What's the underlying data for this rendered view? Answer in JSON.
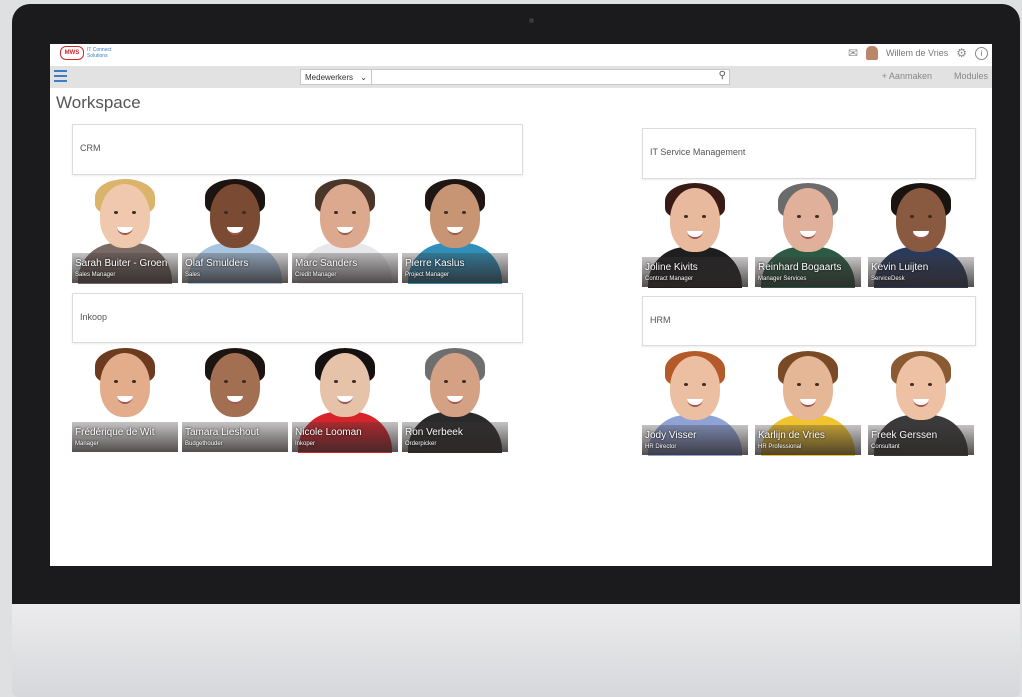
{
  "header": {
    "logo_badge": "MWS",
    "logo_text": "IT Connect Solutions",
    "user_name": "Willem de Vries"
  },
  "toolbar": {
    "search_scope": "Medewerkers",
    "create_label": "+ Aanmaken",
    "modules_label": "Modules"
  },
  "page": {
    "title": "Workspace"
  },
  "groups": [
    {
      "title": "CRM",
      "people": [
        {
          "name": "Sarah Buiter - Groen",
          "role": "Sales Manager",
          "skin": "#f0c8ad",
          "hair": "#d9b46a",
          "shirt": "#7a6a66",
          "bg": "#ffffff"
        },
        {
          "name": "Olaf Smulders",
          "role": "Sales",
          "skin": "#7a4a33",
          "hair": "#1c1411",
          "shirt": "#a8c4de",
          "bg": "#ffffff"
        },
        {
          "name": "Marc Sanders",
          "role": "Credit Manager",
          "skin": "#dca98e",
          "hair": "#4a3628",
          "shirt": "#e8e8ea",
          "bg": "#ffffff"
        },
        {
          "name": "Pierre Kaslus",
          "role": "Project Manager",
          "skin": "#c89574",
          "hair": "#1d1612",
          "shirt": "#2f8fb8",
          "bg": "#ffffff"
        }
      ]
    },
    {
      "title": "Inkoop",
      "people": [
        {
          "name": "Frédérique de Wit",
          "role": "Manager",
          "skin": "#e3ad8c",
          "hair": "#6b3a1f",
          "shirt": "#ffffff",
          "bg": "#ffffff"
        },
        {
          "name": "Tamara Lieshout",
          "role": "Budgethouder",
          "skin": "#a36f52",
          "hair": "#1c1411",
          "shirt": "#ffffff",
          "bg": "#ffffff"
        },
        {
          "name": "Nicole Looman",
          "role": "Inkoper",
          "skin": "#e6c2a8",
          "hair": "#151111",
          "shirt": "#d6242b",
          "bg": "#ffffff"
        },
        {
          "name": "Ron Verbeek",
          "role": "Orderpicker",
          "skin": "#d4a184",
          "hair": "#6e6e6e",
          "shirt": "#2a2a2a",
          "bg": "#ffffff"
        }
      ]
    },
    {
      "title": "IT Service Management",
      "people": [
        {
          "name": "Joline Kivits",
          "role": "Contract Manager",
          "skin": "#e8b99d",
          "hair": "#3a1a14",
          "shirt": "#1e1e1e",
          "bg": "#ffffff"
        },
        {
          "name": "Reinhard Bogaarts",
          "role": "Manager Services",
          "skin": "#e0b09a",
          "hair": "#6b6b6b",
          "shirt": "#2d5a45",
          "bg": "#ffffff"
        },
        {
          "name": "Kevin Luijten",
          "role": "ServiceDesk",
          "skin": "#8a5a40",
          "hair": "#1a1411",
          "shirt": "#2a3a5a",
          "bg": "#ffffff"
        }
      ]
    },
    {
      "title": "HRM",
      "people": [
        {
          "name": "Jody Visser",
          "role": "HR Director",
          "skin": "#edbfa2",
          "hair": "#b45a2a",
          "shirt": "#8fa2d6",
          "bg": "#ffffff"
        },
        {
          "name": "Karlijn de Vries",
          "role": "HR Professional",
          "skin": "#e6b797",
          "hair": "#7a4a26",
          "shirt": "#f0c330",
          "bg": "#ffffff"
        },
        {
          "name": "Freek Gerssen",
          "role": "Consultant",
          "skin": "#eec1a4",
          "hair": "#8a5a32",
          "shirt": "#3a3a3a",
          "bg": "#ffffff"
        }
      ]
    }
  ]
}
